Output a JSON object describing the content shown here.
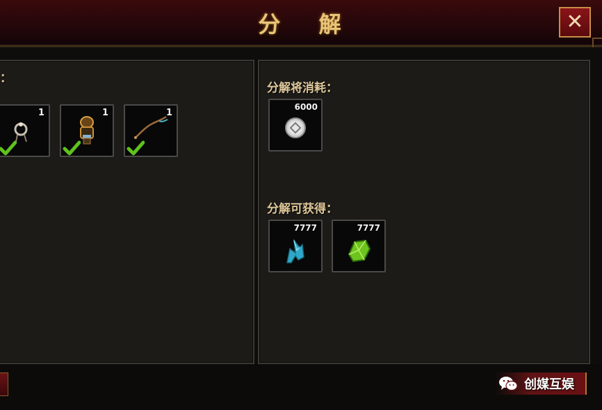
{
  "header": {
    "title": "分 解",
    "close_label": "✕"
  },
  "left_panel": {
    "label_fragment": "：",
    "items": [
      {
        "icon": "ring-icon",
        "count": "1",
        "selected": true
      },
      {
        "icon": "armor-icon",
        "count": "1",
        "selected": true
      },
      {
        "icon": "whip-icon",
        "count": "1",
        "selected": true
      }
    ]
  },
  "right_panel": {
    "cost_label": "分解将消耗：",
    "cost_items": [
      {
        "icon": "silver-coin-icon",
        "count": "6000"
      }
    ],
    "gain_label": "分解可获得：",
    "gain_items": [
      {
        "icon": "blue-crystal-icon",
        "count": "7777"
      },
      {
        "icon": "green-gem-icon",
        "count": "7777"
      }
    ]
  },
  "watermark": {
    "text": "创媒互娱",
    "icon": "wechat-icon"
  },
  "colors": {
    "title_gold": "#e8c47a",
    "label_gold": "#e0c89a",
    "check_green": "#5fc21e",
    "close_red": "#8a1418"
  }
}
